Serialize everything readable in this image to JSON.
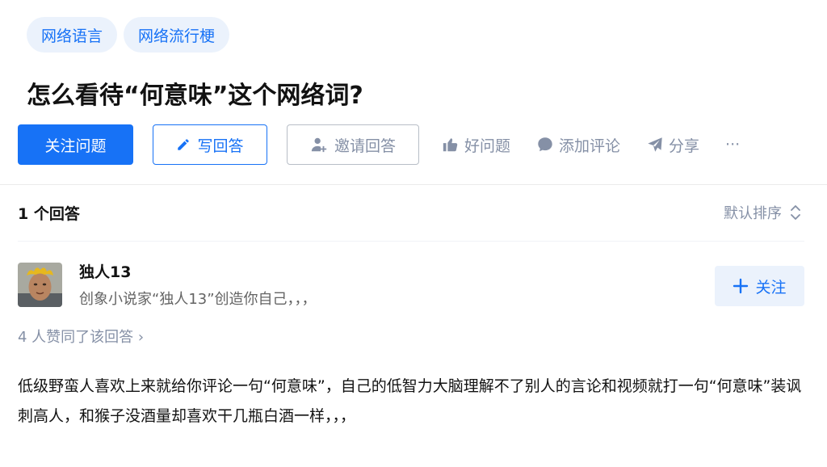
{
  "tags": [
    "网络语言",
    "网络流行梗"
  ],
  "question": {
    "title": "怎么看待“何意味”这个网络词?"
  },
  "actions": {
    "follow_question": "关注问题",
    "write_answer": "写回答",
    "invite_answer": "邀请回答",
    "good_question": "好问题",
    "add_comment": "添加评论",
    "share": "分享",
    "more": "···"
  },
  "answers": {
    "count_label": "1 个回答",
    "sort_label": "默认排序"
  },
  "answer": {
    "author_name": "独人13",
    "author_bio": "创象小说家“独人13”创造你自己，，，",
    "follow_label": "关注",
    "votes_label": "4 人赞同了该回答 ›",
    "content": "低级野蛮人喜欢上来就给你评论一句“何意味”，自己的低智力大脑理解不了别人的言论和视频就打一句“何意味”装讽刺高人，和猴子没酒量却喜欢干几瓶白酒一样，，，"
  },
  "colors": {
    "accent": "#1772f6",
    "muted": "#8590a6",
    "tag_bg": "#ebf2fc"
  },
  "icons": [
    "pencil-icon",
    "invite-user-icon",
    "thumbs-up-icon",
    "comment-icon",
    "share-icon",
    "sort-chevron-icon",
    "plus-icon"
  ]
}
